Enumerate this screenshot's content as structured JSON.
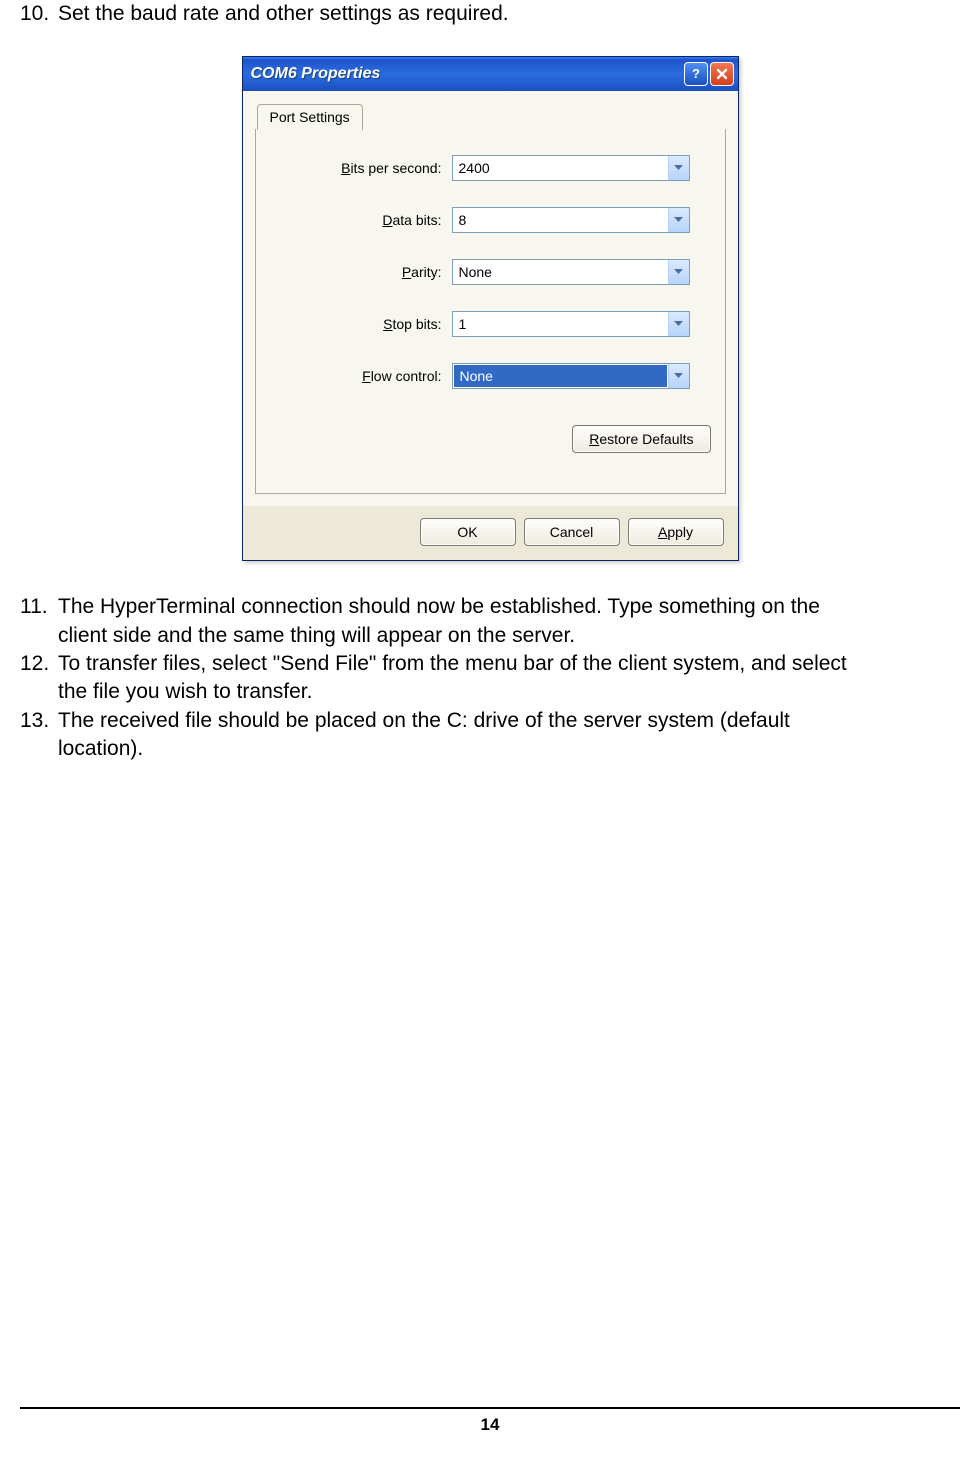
{
  "steps": {
    "s10": {
      "num": "10.",
      "text": "Set the baud rate and other settings as required."
    },
    "s11": {
      "num": "11.",
      "text_a": "The HyperTerminal connection should now be established. Type something on the",
      "text_b": "client side and the same thing will appear on the server."
    },
    "s12": {
      "num": "12.",
      "text_a": "To transfer files, select \"Send File\" from the menu bar of the client system, and select",
      "text_b": "the file you wish to transfer."
    },
    "s13": {
      "num": "13.",
      "text_a": "The received file should be placed on the C: drive of the server system (default",
      "text_b": "location)."
    }
  },
  "dialog": {
    "title": "COM6 Properties",
    "tab_label": "Port Settings",
    "fields": {
      "bits_per_second": {
        "label_pre": "B",
        "label_rest": "its per second:",
        "value": "2400"
      },
      "data_bits": {
        "label_pre": "D",
        "label_rest": "ata bits:",
        "value": "8"
      },
      "parity": {
        "label_pre": "P",
        "label_rest": "arity:",
        "value": "None"
      },
      "stop_bits": {
        "label_pre": "S",
        "label_rest": "top bits:",
        "value": "1"
      },
      "flow_control": {
        "label_pre": "F",
        "label_rest": "low control:",
        "value": "None"
      }
    },
    "buttons": {
      "restore_pre": "R",
      "restore_rest": "estore Defaults",
      "ok": "OK",
      "cancel": "Cancel",
      "apply_pre": "A",
      "apply_rest": "pply"
    }
  },
  "page_number": "14"
}
